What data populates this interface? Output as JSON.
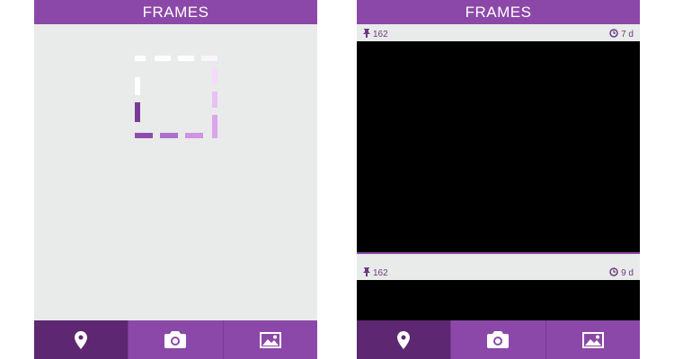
{
  "colors": {
    "header_bg": "#8c48a8",
    "tab_bg": "#8c48a8",
    "tab_active_bg": "#5d2771",
    "content_bg": "#e8ebea",
    "accent_text": "#6b3a80",
    "image_bg": "#000000"
  },
  "left_screen": {
    "title": "FRAMES",
    "loading_icon": "dashed-square-loader"
  },
  "right_screen": {
    "title": "FRAMES",
    "posts": [
      {
        "pin_icon": "pin-icon",
        "pins": "162",
        "time_icon": "clock-icon",
        "age": "7 d"
      },
      {
        "pin_icon": "pin-icon",
        "pins": "162",
        "time_icon": "clock-icon",
        "age": "9 d"
      }
    ]
  },
  "tab_bar": {
    "tabs": [
      {
        "icon": "location-pin-icon",
        "active": true
      },
      {
        "icon": "camera-icon",
        "active": false
      },
      {
        "icon": "gallery-icon",
        "active": false
      }
    ]
  }
}
